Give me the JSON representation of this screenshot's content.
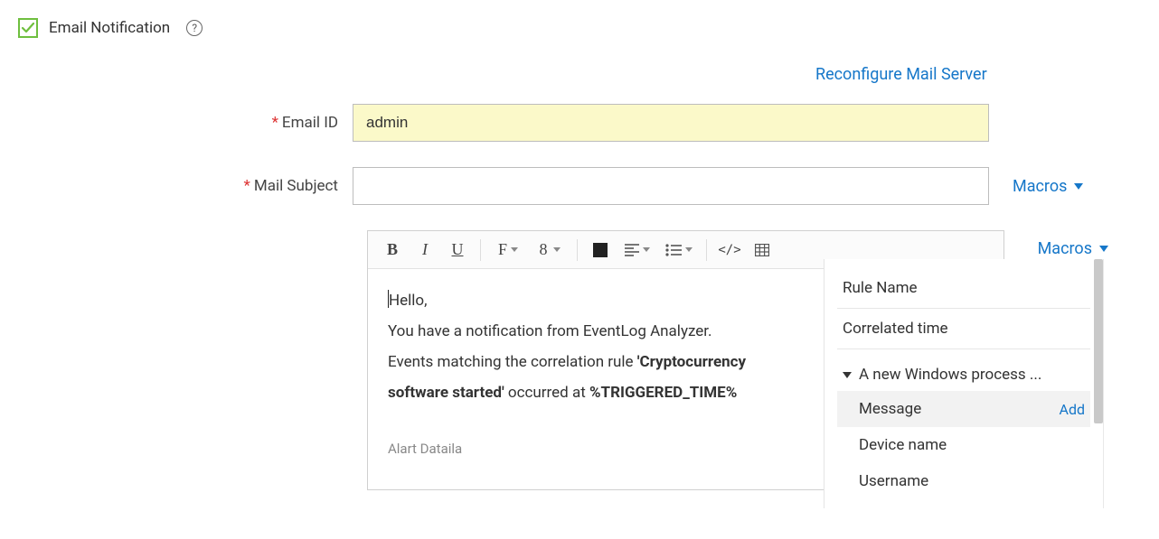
{
  "section": {
    "title": "Email Notification",
    "top_link": "Reconfigure Mail Server"
  },
  "form": {
    "email_label": "Email ID",
    "email_value": "admin",
    "subject_label": "Mail Subject",
    "subject_value": "",
    "macros_label": "Macros"
  },
  "toolbar": {
    "bold": "B",
    "italic": "I",
    "underline": "U",
    "font": "F",
    "size": "8",
    "code": "</>"
  },
  "body": {
    "line1": "Hello,",
    "line2": "You have a notification from EventLog Analyzer.",
    "line3_a": "Events matching the correlation rule ",
    "line3_b": "'Cryptocurrency",
    "line4_a": "software started'",
    "line4_b": " occurred at ",
    "line4_c": "%TRIGGERED_TIME%",
    "partial": "Alart Dataila"
  },
  "macro_panel": {
    "item1": "Rule Name",
    "item2": "Correlated time",
    "group": "A new Windows process ...",
    "sub1": "Message",
    "sub1_action": "Add",
    "sub2": "Device name",
    "sub3": "Username"
  }
}
